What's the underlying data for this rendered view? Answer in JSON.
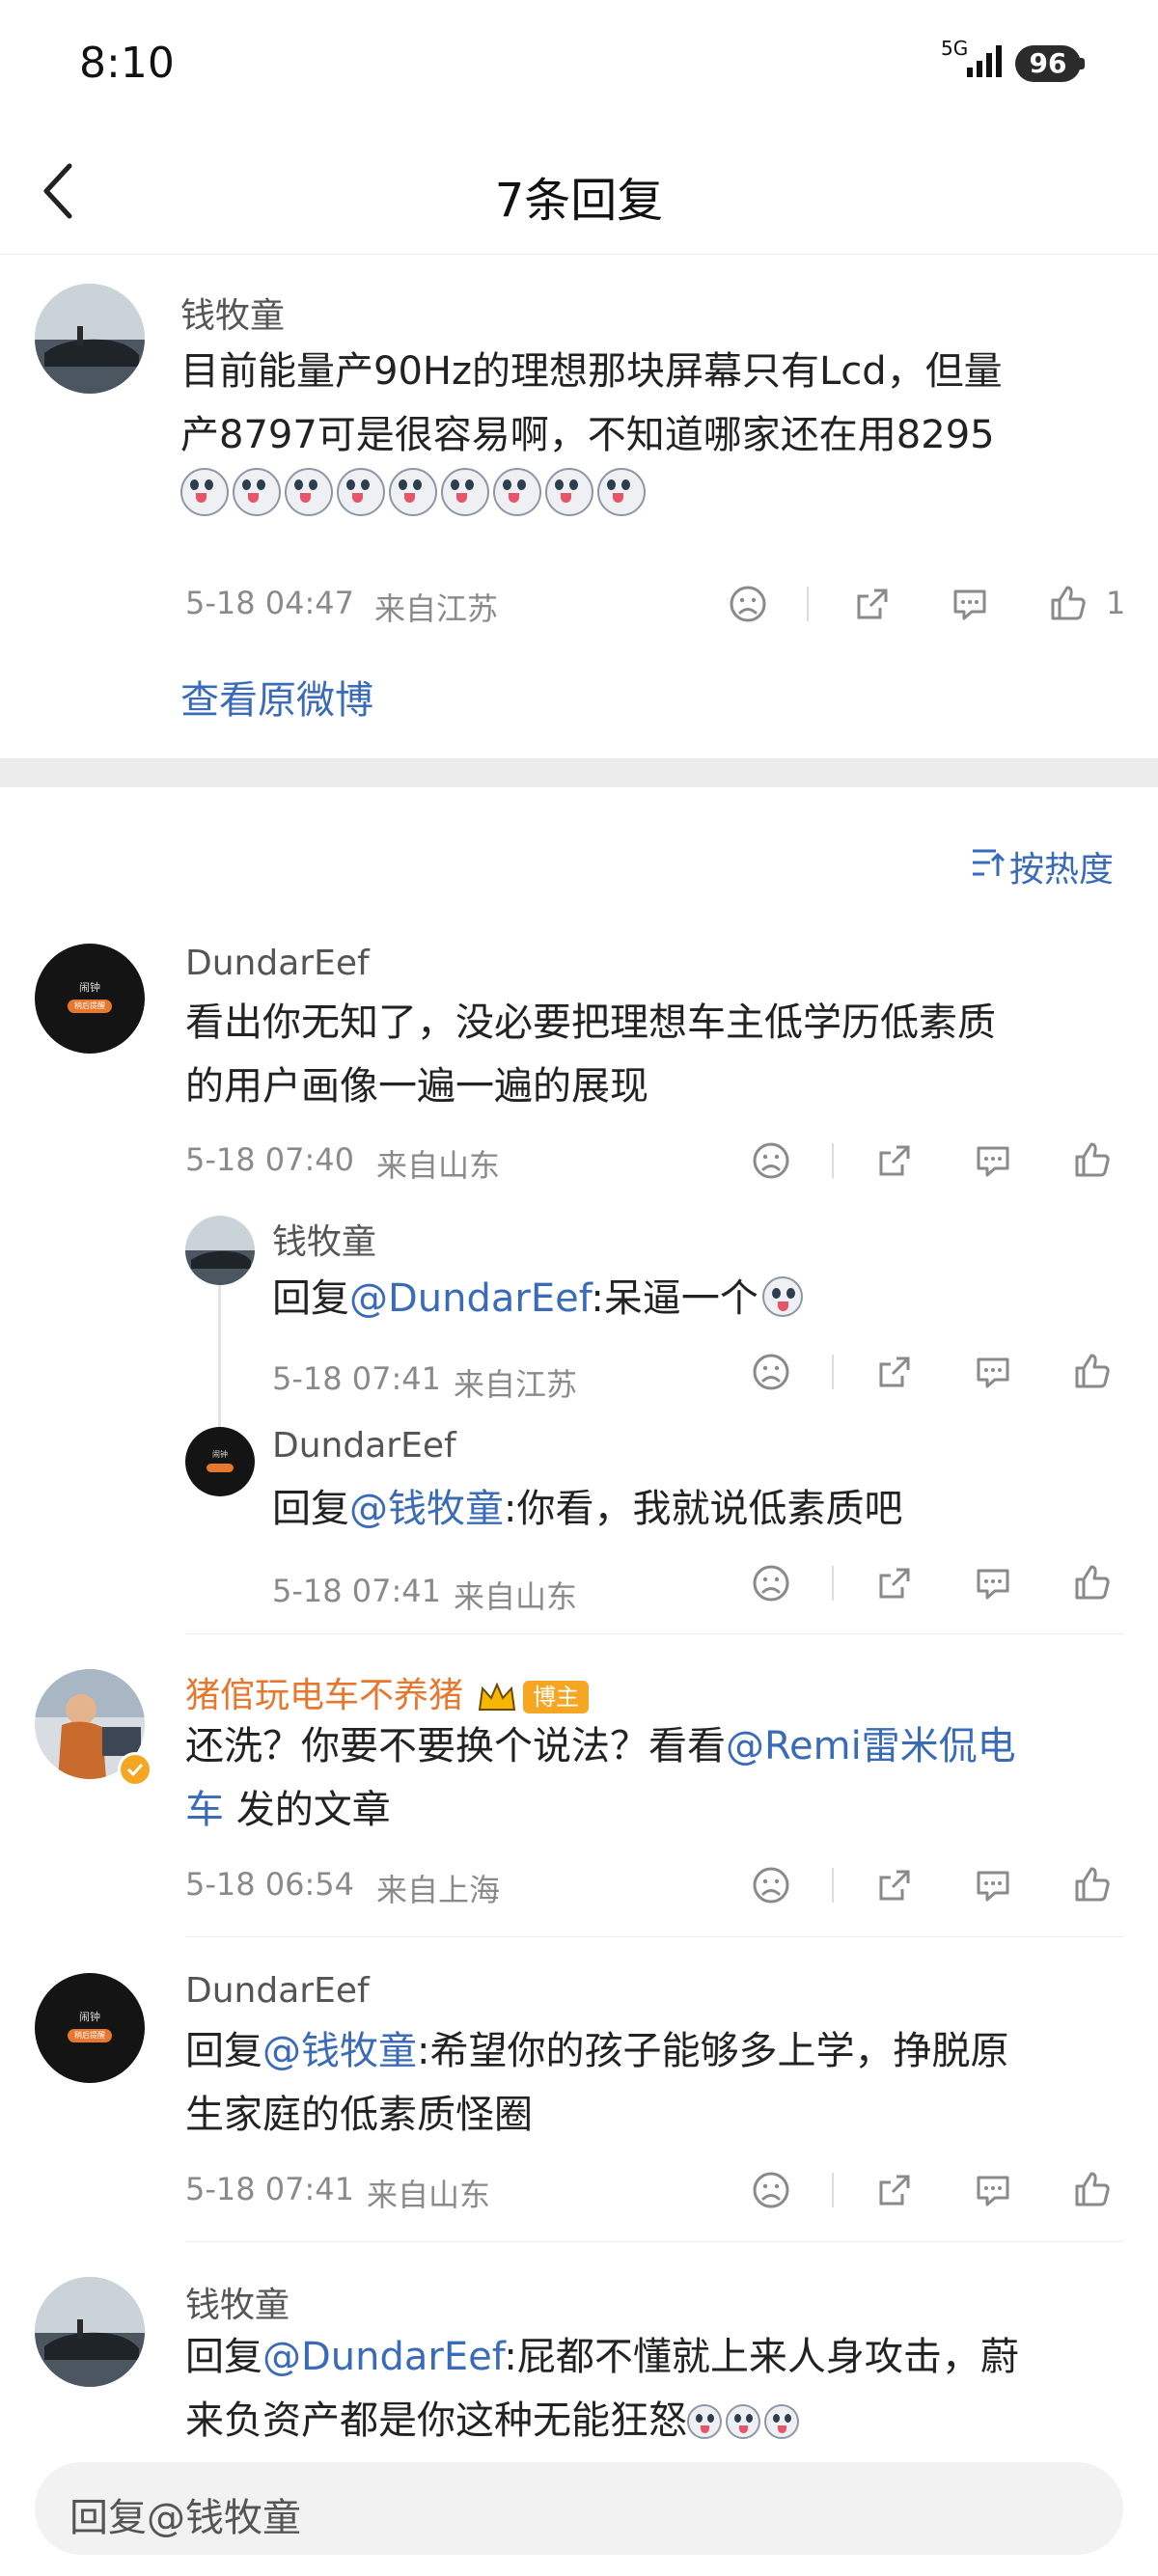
{
  "status_bar": {
    "time": "8:10",
    "network": "5G",
    "battery": "96"
  },
  "header": {
    "title": "7条回复"
  },
  "root_comment": {
    "name": "钱牧童",
    "text_line1": "目前能量产90Hz的理想那块屏幕只有Lcd，但量",
    "text_line2": "产8797可是很容易啊，不知道哪家还在用8295",
    "emoji_count": 9,
    "time": "5-18 04:47",
    "location": "来自江苏",
    "likes": "1",
    "view_original": "查看原微博"
  },
  "sort": {
    "label": "按热度"
  },
  "comments": [
    {
      "name": "DundarEef",
      "line1": "看出你无知了，没必要把理想车主低学历低素质",
      "line2": "的用户画像一遍一遍的展现",
      "time": "5-18 07:40",
      "location": "来自山东",
      "avatar_text": "闹钟",
      "avatar_btn": "稍后提醒"
    },
    {
      "name": "钱牧童",
      "prefix": "回复",
      "mention": "@DundarEef",
      "rest": ":呆逼一个",
      "time": "5-18 07:41",
      "location": "来自江苏"
    },
    {
      "name": "DundarEef",
      "prefix": "回复",
      "mention": "@钱牧童",
      "rest": ":你看，我就说低素质吧",
      "time": "5-18 07:41",
      "location": "来自山东",
      "avatar_text": "闹钟"
    },
    {
      "name": "猪倌玩电车不养猪",
      "badge": "博主",
      "line1_a": "还洗？你要不要换个说法？看看",
      "line1_mention": "@Remi雷米侃电",
      "line2_mention": "车",
      "line2_rest": " 发的文章",
      "time": "5-18 06:54",
      "location": "来自上海"
    },
    {
      "name": "DundarEef",
      "prefix": "回复",
      "mention": "@钱牧童",
      "rest": ":希望你的孩子能够多上学，挣脱原",
      "line2": "生家庭的低素质怪圈",
      "time": "5-18 07:41",
      "location": "来自山东",
      "avatar_text": "闹钟",
      "avatar_btn": "稍后提醒"
    },
    {
      "name": "钱牧童",
      "prefix": "回复",
      "mention": "@DundarEef",
      "rest": ":屁都不懂就上来人身攻击，蔚",
      "line2": "来负资产都是你这种无能狂怒"
    }
  ],
  "reply_input": {
    "placeholder": "回复@钱牧童"
  },
  "colors": {
    "link": "#3a6bb8",
    "vip_name": "#e8772e",
    "badge": "#f5a623"
  },
  "icons": [
    "back-icon",
    "dislike-icon",
    "share-icon",
    "comment-icon",
    "like-icon",
    "sort-icon"
  ]
}
